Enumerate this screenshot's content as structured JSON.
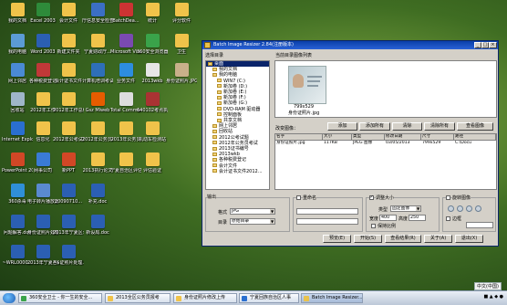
{
  "desktop_icons": [
    {
      "label": "我的文档",
      "color": "#f0c34a"
    },
    {
      "label": "Excel 2003",
      "color": "#2e8b3a"
    },
    {
      "label": "会计文件",
      "color": "#f0c34a"
    },
    {
      "label": "厅信息安全检查表",
      "color": "#3b6fc4"
    },
    {
      "label": "BatchDea...",
      "color": "#c33"
    },
    {
      "label": "统计",
      "color": "#f0c34a"
    },
    {
      "label": "评分软件",
      "color": "#f0c34a"
    },
    {
      "label": "我的电脑",
      "color": "#5b9bd5"
    },
    {
      "label": "Word 2003",
      "color": "#2b5fb3"
    },
    {
      "label": "新建文件夹",
      "color": "#f0c34a"
    },
    {
      "label": "宁夏财政厅...",
      "color": "#f0c34a"
    },
    {
      "label": "Microsoft Visual...",
      "color": "#7a4ab0"
    },
    {
      "label": "360安全浏览器",
      "color": "#3aa34a"
    },
    {
      "label": "卫生",
      "color": "#f0c34a"
    },
    {
      "label": "网上邻居",
      "color": "#4a8ad4"
    },
    {
      "label": "各种税费登记",
      "color": "#c03838"
    },
    {
      "label": "会计证书文件",
      "color": "#f0c34a"
    },
    {
      "label": "计算机培训考试",
      "color": "#2e6fb8"
    },
    {
      "label": "业务文件",
      "color": "#2d8de0"
    },
    {
      "label": "2013wkb",
      "color": "#e6e6e6"
    },
    {
      "label": "身份证照片.JPG",
      "color": "#c8b08a"
    },
    {
      "label": "回收站",
      "color": "#9fb6c9"
    },
    {
      "label": "2012年工作",
      "color": "#f0c34a"
    },
    {
      "label": "2012年工作总结",
      "color": "#f0c34a"
    },
    {
      "label": "Gsz Mlweb",
      "color": "#e65c00"
    },
    {
      "label": "Total Commander",
      "color": "#ddd"
    },
    {
      "label": "640102考点执行.rar",
      "color": "#a33"
    },
    {
      "label": "Internet Explorer",
      "color": "#2a6fd0"
    },
    {
      "label": "信息化",
      "color": "#f0c34a"
    },
    {
      "label": "2012年公考试题",
      "color": "#f0c34a"
    },
    {
      "label": "2012年公务员考试",
      "color": "#f0c34a"
    },
    {
      "label": "2013年公务员",
      "color": "#f0c34a"
    },
    {
      "label": "机动车检测站",
      "color": "#f0c34a"
    },
    {
      "label": "PowerPoint 2003",
      "color": "#d24726"
    },
    {
      "label": "网事公司",
      "color": "#3a7bd5"
    },
    {
      "label": "新PPT",
      "color": "#d24726"
    },
    {
      "label": "2013执行论文",
      "color": "#f0c34a"
    },
    {
      "label": "宁夏自治区评估",
      "color": "#f0c34a"
    },
    {
      "label": "评估验证",
      "color": "#f0c34a"
    },
    {
      "label": "360杀毒",
      "color": "#2f8fd8"
    },
    {
      "label": "电子转片播放器",
      "color": "#5a8ad0"
    },
    {
      "label": "20090710...",
      "color": "#2b5fb3"
    },
    {
      "label": "补充.doc",
      "color": "#2b5fb3"
    },
    {
      "label": "问题解答.doc",
      "color": "#2b5fb3"
    },
    {
      "label": "身份证照片处理.doc",
      "color": "#2b5fb3"
    },
    {
      "label": "2013年宁夏区公务员",
      "color": "#2b5fb3"
    },
    {
      "label": "新设局.doc",
      "color": "#2b5fb3"
    },
    {
      "label": "~WRL0000...",
      "color": "#2b5fb3"
    },
    {
      "label": "2013年宁夏各级机关",
      "color": "#2b5fb3"
    },
    {
      "label": "~$证照片处理.doc",
      "color": "#2b5fb3"
    }
  ],
  "window": {
    "title": "Batch Image Resizer 2.84(注册版本)",
    "source_label": "选择目录",
    "current_dir_label": "当前目录图像列表",
    "tree": [
      {
        "label": "桌面",
        "level": 0,
        "selected": true
      },
      {
        "label": "我的文档",
        "level": 1
      },
      {
        "label": "我的电脑",
        "level": 1
      },
      {
        "label": "WIN7 (C:)",
        "level": 2
      },
      {
        "label": "新加卷 (D:)",
        "level": 2
      },
      {
        "label": "新加卷 (E:)",
        "level": 2
      },
      {
        "label": "新加卷 (F:)",
        "level": 2
      },
      {
        "label": "新加卷 (G:)",
        "level": 2
      },
      {
        "label": "DVD-RAM 驱动器",
        "level": 2
      },
      {
        "label": "控制面板",
        "level": 2
      },
      {
        "label": "共享文档",
        "level": 2
      },
      {
        "label": "网上邻居",
        "level": 1
      },
      {
        "label": "回收站",
        "level": 1
      },
      {
        "label": "2012公考试题",
        "level": 1
      },
      {
        "label": "2012年公务员考试",
        "level": 1
      },
      {
        "label": "2013证书编号",
        "level": 1
      },
      {
        "label": "2013wkb",
        "level": 1
      },
      {
        "label": "各种税费登记",
        "level": 1
      },
      {
        "label": "会计文件",
        "level": 1
      },
      {
        "label": "会计证书文件2012...",
        "level": 1
      }
    ],
    "thumbnail": {
      "caption1": "799x529",
      "caption2": "身份证照片.jpg"
    },
    "list_label": "改变图像：",
    "buttons": {
      "add": "添加",
      "add_all": "添加所有",
      "clear": "清除",
      "clear_all": "清除所有",
      "view": "查看图像"
    },
    "list_columns": [
      "名字",
      "大小",
      "类型",
      "修改日期",
      "尺寸",
      "路径"
    ],
    "list_rows": [
      [
        "身份证照片.jpg",
        "117KB",
        "JPEG 图像",
        "03/05/2013",
        "799x529",
        "C:\\Docu"
      ]
    ],
    "output": {
      "group_label": "输出",
      "format_label": "格式",
      "format_value": "JPG",
      "dir_label": "目录",
      "dir_value": "原始目录"
    },
    "rename": {
      "label": "重命名",
      "checked": false,
      "rows": [
        "",
        ""
      ]
    },
    "resize": {
      "label": "调整大小",
      "checked": true,
      "type_label": "类型",
      "type_value": "固定图像",
      "width_label": "宽度",
      "width_value": "400",
      "height_label": "高度",
      "height_value": "250",
      "keep_ratio_label": "保持比例",
      "keep_ratio_checked": false
    },
    "rotate": {
      "label": "旋转图像",
      "checked": false,
      "border_label": "边框",
      "border_checked": false
    },
    "footer_buttons": {
      "preview": "预览(E)",
      "start": "开始(S)",
      "view_result": "查看结果(R)",
      "about": "关于(A)",
      "exit": "退出(X)"
    }
  },
  "taskbar": {
    "ime": "中文(中国)",
    "buttons": [
      {
        "label": "360安全卫士 - 你一生的安全...",
        "color": "#3aa34a"
      },
      {
        "label": "2013全区公务员报考",
        "color": "#f0c34a"
      },
      {
        "label": "身份证照片修改上传",
        "color": "#f0c34a"
      },
      {
        "label": "宁夏回族自治区人事",
        "color": "#2a6fd0"
      },
      {
        "label": "Batch Image Resizer...",
        "color": "#e9c24c"
      }
    ],
    "tray_text": "■ ▲ ◆ ●"
  }
}
